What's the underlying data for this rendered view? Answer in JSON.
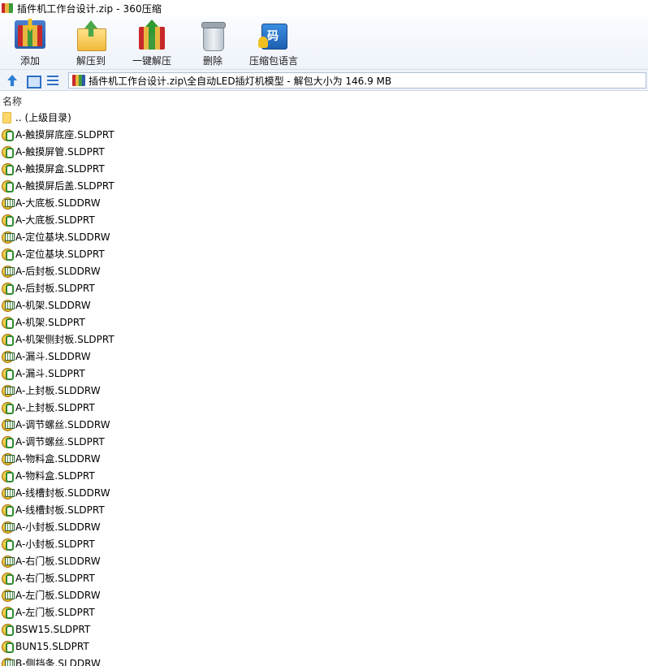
{
  "window": {
    "title": "插件机工作台设计.zip - 360压缩"
  },
  "toolbar": {
    "buttons": [
      {
        "label": "添加",
        "icon": "add-to-archive-icon"
      },
      {
        "label": "解压到",
        "icon": "extract-to-folder-icon"
      },
      {
        "label": "一键解压",
        "icon": "one-click-extract-icon"
      },
      {
        "label": "删除",
        "icon": "delete-trash-icon"
      },
      {
        "label": "压缩包语言",
        "icon": "archive-language-icon",
        "glyph": "码"
      }
    ]
  },
  "addressbar": {
    "path": "插件机工作台设计.zip\\全自动LED插灯机模型 - 解包大小为 146.9 MB"
  },
  "list": {
    "column_name": "名称",
    "parent_entry": ".. (上级目录)",
    "items": [
      {
        "name": "A-触摸屏底座.SLDPRT",
        "type": "prt"
      },
      {
        "name": "A-触摸屏管.SLDPRT",
        "type": "prt"
      },
      {
        "name": "A-触摸屏盒.SLDPRT",
        "type": "prt"
      },
      {
        "name": "A-触摸屏后盖.SLDPRT",
        "type": "prt"
      },
      {
        "name": "A-大底板.SLDDRW",
        "type": "drw"
      },
      {
        "name": "A-大底板.SLDPRT",
        "type": "prt"
      },
      {
        "name": "A-定位基块.SLDDRW",
        "type": "drw"
      },
      {
        "name": "A-定位基块.SLDPRT",
        "type": "prt"
      },
      {
        "name": "A-后封板.SLDDRW",
        "type": "drw"
      },
      {
        "name": "A-后封板.SLDPRT",
        "type": "prt"
      },
      {
        "name": "A-机架.SLDDRW",
        "type": "drw"
      },
      {
        "name": "A-机架.SLDPRT",
        "type": "prt"
      },
      {
        "name": "A-机架侧封板.SLDPRT",
        "type": "prt"
      },
      {
        "name": "A-漏斗.SLDDRW",
        "type": "drw"
      },
      {
        "name": "A-漏斗.SLDPRT",
        "type": "prt"
      },
      {
        "name": "A-上封板.SLDDRW",
        "type": "drw"
      },
      {
        "name": "A-上封板.SLDPRT",
        "type": "prt"
      },
      {
        "name": "A-调节螺丝.SLDDRW",
        "type": "drw"
      },
      {
        "name": "A-调节螺丝.SLDPRT",
        "type": "prt"
      },
      {
        "name": "A-物料盒.SLDDRW",
        "type": "drw"
      },
      {
        "name": "A-物料盒.SLDPRT",
        "type": "prt"
      },
      {
        "name": "A-线槽封板.SLDDRW",
        "type": "drw"
      },
      {
        "name": "A-线槽封板.SLDPRT",
        "type": "prt"
      },
      {
        "name": "A-小封板.SLDDRW",
        "type": "drw"
      },
      {
        "name": "A-小封板.SLDPRT",
        "type": "prt"
      },
      {
        "name": "A-右门板.SLDDRW",
        "type": "drw"
      },
      {
        "name": "A-右门板.SLDPRT",
        "type": "prt"
      },
      {
        "name": "A-左门板.SLDDRW",
        "type": "drw"
      },
      {
        "name": "A-左门板.SLDPRT",
        "type": "prt"
      },
      {
        "name": "BSW15.SLDPRT",
        "type": "prt"
      },
      {
        "name": "BUN15.SLDPRT",
        "type": "prt"
      },
      {
        "name": "B-侧挡条.SLDDRW",
        "type": "drw"
      }
    ]
  }
}
